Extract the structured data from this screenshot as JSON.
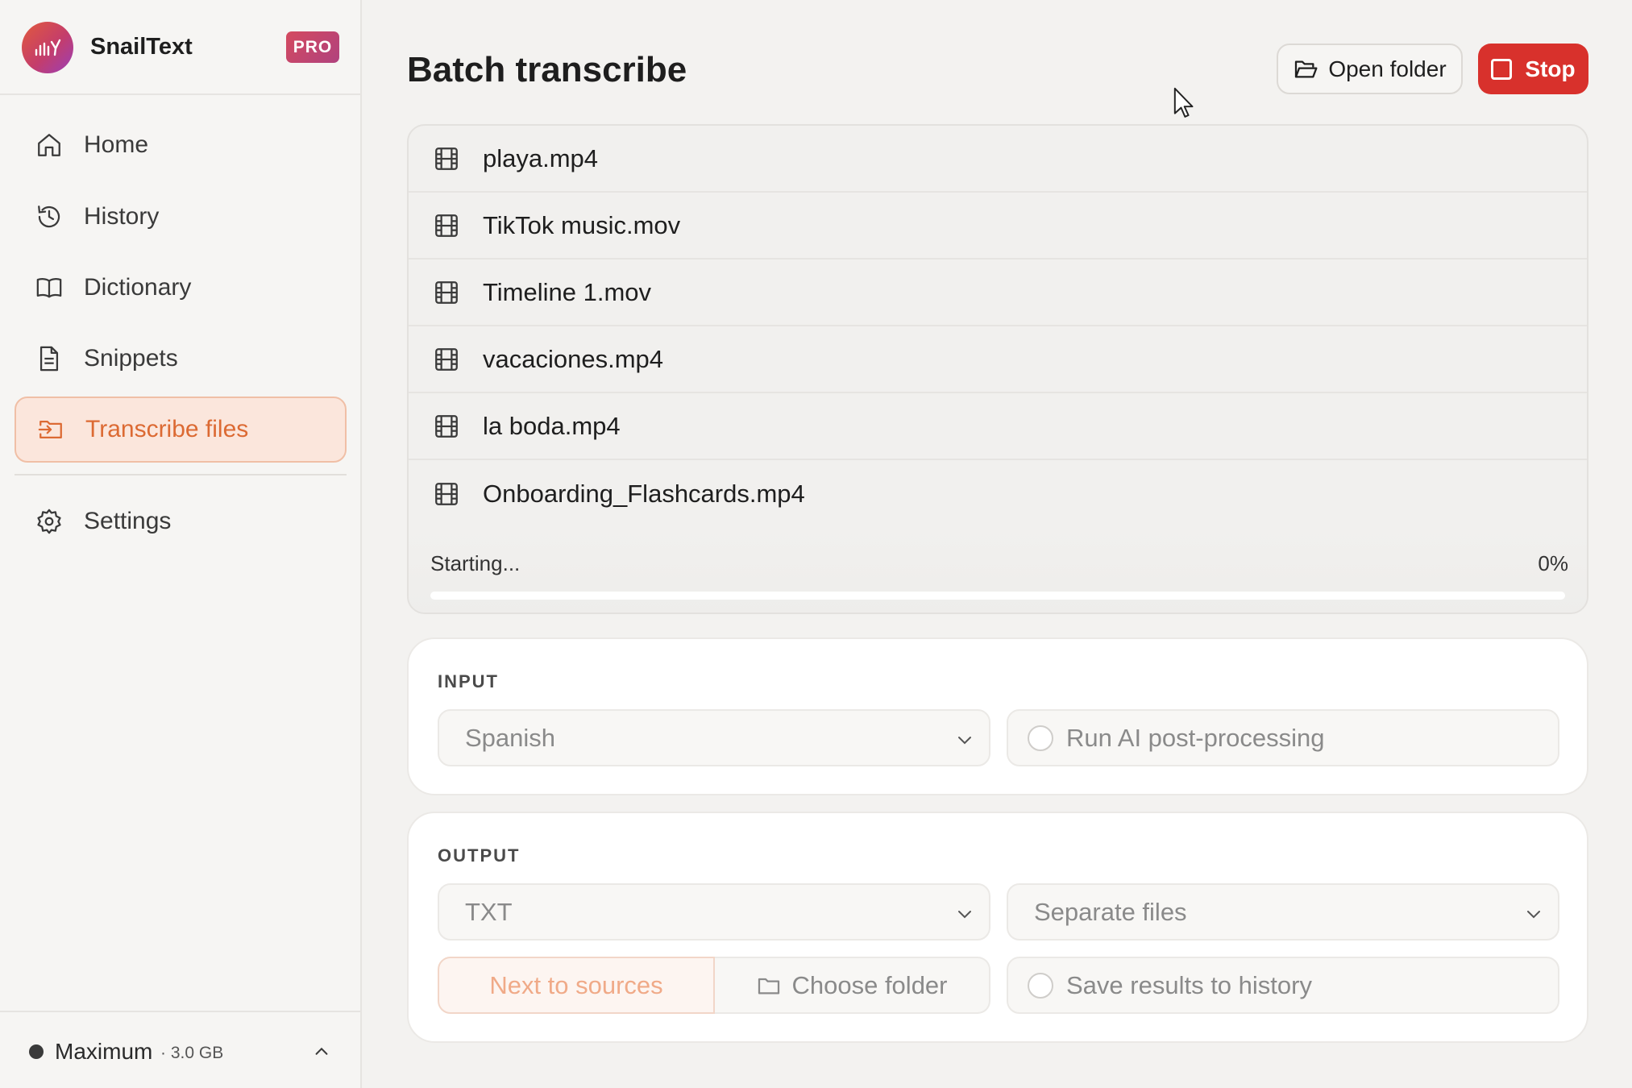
{
  "app": {
    "name": "SnailText",
    "badge": "PRO"
  },
  "sidebar": {
    "items": [
      {
        "label": "Home",
        "icon": "home-icon"
      },
      {
        "label": "History",
        "icon": "history-icon"
      },
      {
        "label": "Dictionary",
        "icon": "book-icon"
      },
      {
        "label": "Snippets",
        "icon": "document-icon"
      },
      {
        "label": "Transcribe files",
        "icon": "file-import-icon",
        "active": true
      },
      {
        "label": "Settings",
        "icon": "gear-icon"
      }
    ],
    "footer": {
      "mode": "Maximum",
      "size": "· 3.0 GB"
    }
  },
  "header": {
    "title": "Batch transcribe",
    "open_folder_label": "Open folder",
    "stop_label": "Stop"
  },
  "files": [
    {
      "name": "playa.mp4"
    },
    {
      "name": "TikTok music.mov"
    },
    {
      "name": "Timeline 1.mov"
    },
    {
      "name": "vacaciones.mp4"
    },
    {
      "name": "la boda.mp4"
    },
    {
      "name": "Onboarding_Flashcards.mp4"
    }
  ],
  "progress": {
    "status": "Starting...",
    "percent_label": "0%",
    "percent": 0
  },
  "input": {
    "title": "INPUT",
    "language": "Spanish",
    "ai_postprocess_label": "Run AI post-processing"
  },
  "output": {
    "title": "OUTPUT",
    "format": "TXT",
    "grouping": "Separate files",
    "next_to_sources_label": "Next to sources",
    "choose_folder_label": "Choose folder",
    "save_history_label": "Save results to history"
  },
  "colors": {
    "accent": "#dc6a33",
    "stop": "#d8312c",
    "active_bg": "#fbe6dc"
  }
}
